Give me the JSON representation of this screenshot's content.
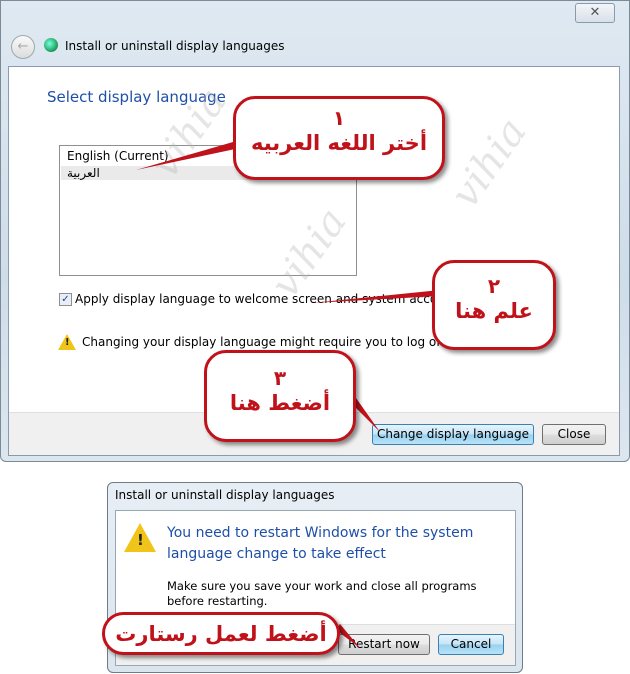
{
  "main_window": {
    "nav_title": "Install or uninstall display languages",
    "heading": "Select display language",
    "languages": [
      "English (Current)",
      "العربية"
    ],
    "selected_language": "العربية",
    "checkbox_label": "Apply display language to welcome screen and system accounts",
    "checkbox_checked": true,
    "warning_text": "Changing your display language might require you to log off or restart.",
    "change_button": "Change display language",
    "close_button": "Close",
    "close_icon": "✕"
  },
  "restart_dialog": {
    "title": "Install or uninstall display languages",
    "heading": "You need to restart Windows for the system language change to take effect",
    "body": "Make sure you save your work and close all programs before restarting.",
    "restart_button": "Restart now",
    "cancel_button": "Cancel"
  },
  "annotations": [
    {
      "number": "١",
      "text": "أختر اللغه العربيه"
    },
    {
      "number": "٢",
      "text": "علم هنا"
    },
    {
      "number": "٣",
      "text": "أضغط هنا"
    },
    {
      "number": "",
      "text": "أضغط لعمل رستارت"
    }
  ],
  "colors": {
    "accent": "#1e4fa8",
    "callout": "#c0121a"
  }
}
